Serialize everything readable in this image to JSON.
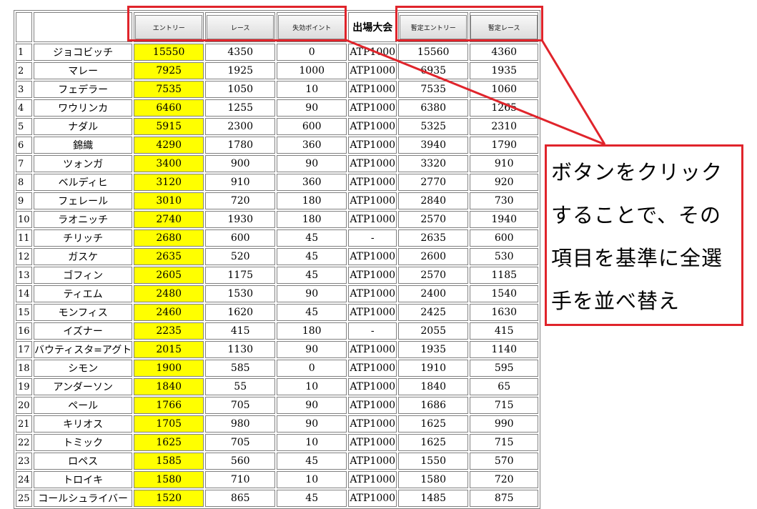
{
  "columns": {
    "entry": "エントリー",
    "race": "レース",
    "lost_points": "失効ポイント",
    "event": "出場大会",
    "provisional_entry": "暫定エントリー",
    "provisional_race": "暫定レース"
  },
  "rows": [
    {
      "rank": "1",
      "name": "ジョコビッチ",
      "entry": "15550",
      "race": "4350",
      "lost": "0",
      "event": "ATP1000",
      "pentry": "15560",
      "prace": "4360"
    },
    {
      "rank": "2",
      "name": "マレー",
      "entry": "7925",
      "race": "1925",
      "lost": "1000",
      "event": "ATP1000",
      "pentry": "6935",
      "prace": "1935"
    },
    {
      "rank": "3",
      "name": "フェデラー",
      "entry": "7535",
      "race": "1050",
      "lost": "10",
      "event": "ATP1000",
      "pentry": "7535",
      "prace": "1060"
    },
    {
      "rank": "4",
      "name": "ワウリンカ",
      "entry": "6460",
      "race": "1255",
      "lost": "90",
      "event": "ATP1000",
      "pentry": "6380",
      "prace": "1265"
    },
    {
      "rank": "5",
      "name": "ナダル",
      "entry": "5915",
      "race": "2300",
      "lost": "600",
      "event": "ATP1000",
      "pentry": "5325",
      "prace": "2310"
    },
    {
      "rank": "6",
      "name": "錦織",
      "entry": "4290",
      "race": "1780",
      "lost": "360",
      "event": "ATP1000",
      "pentry": "3940",
      "prace": "1790"
    },
    {
      "rank": "7",
      "name": "ツォンガ",
      "entry": "3400",
      "race": "900",
      "lost": "90",
      "event": "ATP1000",
      "pentry": "3320",
      "prace": "910"
    },
    {
      "rank": "8",
      "name": "ベルディヒ",
      "entry": "3120",
      "race": "910",
      "lost": "360",
      "event": "ATP1000",
      "pentry": "2770",
      "prace": "920"
    },
    {
      "rank": "9",
      "name": "フェレール",
      "entry": "3010",
      "race": "720",
      "lost": "180",
      "event": "ATP1000",
      "pentry": "2840",
      "prace": "730"
    },
    {
      "rank": "10",
      "name": "ラオニッチ",
      "entry": "2740",
      "race": "1930",
      "lost": "180",
      "event": "ATP1000",
      "pentry": "2570",
      "prace": "1940"
    },
    {
      "rank": "11",
      "name": "チリッチ",
      "entry": "2680",
      "race": "600",
      "lost": "45",
      "event": "-",
      "pentry": "2635",
      "prace": "600"
    },
    {
      "rank": "12",
      "name": "ガスケ",
      "entry": "2635",
      "race": "520",
      "lost": "45",
      "event": "ATP1000",
      "pentry": "2600",
      "prace": "530"
    },
    {
      "rank": "13",
      "name": "ゴフィン",
      "entry": "2605",
      "race": "1175",
      "lost": "45",
      "event": "ATP1000",
      "pentry": "2570",
      "prace": "1185"
    },
    {
      "rank": "14",
      "name": "ティエム",
      "entry": "2480",
      "race": "1530",
      "lost": "90",
      "event": "ATP1000",
      "pentry": "2400",
      "prace": "1540"
    },
    {
      "rank": "15",
      "name": "モンフィス",
      "entry": "2460",
      "race": "1620",
      "lost": "45",
      "event": "ATP1000",
      "pentry": "2425",
      "prace": "1630"
    },
    {
      "rank": "16",
      "name": "イズナー",
      "entry": "2235",
      "race": "415",
      "lost": "180",
      "event": "-",
      "pentry": "2055",
      "prace": "415"
    },
    {
      "rank": "17",
      "name": "バウティスタ=アグト",
      "entry": "2015",
      "race": "1130",
      "lost": "90",
      "event": "ATP1000",
      "pentry": "1935",
      "prace": "1140"
    },
    {
      "rank": "18",
      "name": "シモン",
      "entry": "1900",
      "race": "585",
      "lost": "0",
      "event": "ATP1000",
      "pentry": "1910",
      "prace": "595"
    },
    {
      "rank": "19",
      "name": "アンダーソン",
      "entry": "1840",
      "race": "55",
      "lost": "10",
      "event": "ATP1000",
      "pentry": "1840",
      "prace": "65"
    },
    {
      "rank": "20",
      "name": "ペール",
      "entry": "1766",
      "race": "705",
      "lost": "90",
      "event": "ATP1000",
      "pentry": "1686",
      "prace": "715"
    },
    {
      "rank": "21",
      "name": "キリオス",
      "entry": "1705",
      "race": "980",
      "lost": "90",
      "event": "ATP1000",
      "pentry": "1625",
      "prace": "990"
    },
    {
      "rank": "22",
      "name": "トミック",
      "entry": "1625",
      "race": "705",
      "lost": "10",
      "event": "ATP1000",
      "pentry": "1625",
      "prace": "715"
    },
    {
      "rank": "23",
      "name": "ロペス",
      "entry": "1585",
      "race": "560",
      "lost": "45",
      "event": "ATP1000",
      "pentry": "1550",
      "prace": "570"
    },
    {
      "rank": "24",
      "name": "トロイキ",
      "entry": "1580",
      "race": "710",
      "lost": "10",
      "event": "ATP1000",
      "pentry": "1580",
      "prace": "720"
    },
    {
      "rank": "25",
      "name": "コールシュライバー",
      "entry": "1520",
      "race": "865",
      "lost": "45",
      "event": "ATP1000",
      "pentry": "1485",
      "prace": "875"
    }
  ],
  "callout": {
    "line1": "ボタンをクリック",
    "line2": "することで、その",
    "line3": "項目を基準に全選",
    "line4": "手を並べ替え"
  },
  "colors": {
    "highlight": "#ffff00",
    "annotation": "#e0242b"
  }
}
